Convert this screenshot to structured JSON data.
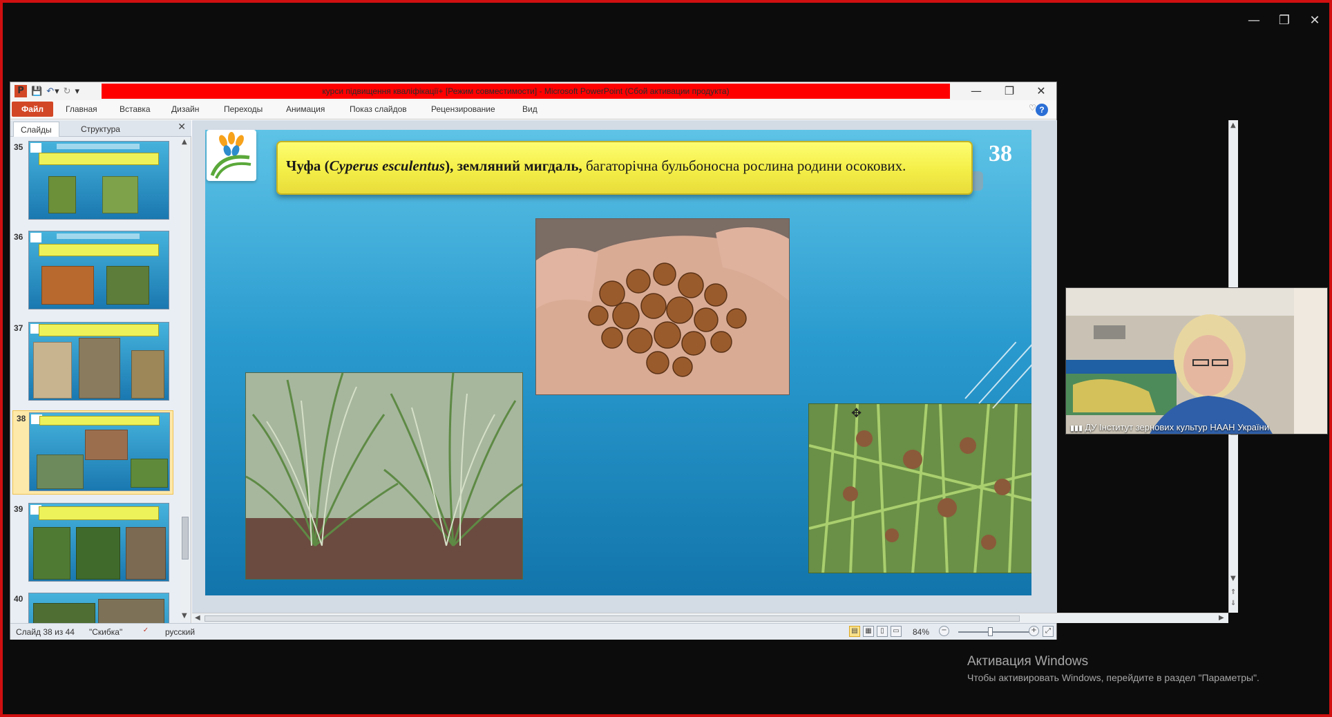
{
  "outer_window": {
    "controls": [
      "—",
      "❐",
      "✕"
    ]
  },
  "ppt": {
    "title": "курси підвищення кваліфікації+ [Режим совместимости]  -  Microsoft PowerPoint (Сбой активации продукта)",
    "qat": {
      "logo": "P",
      "save": "💾",
      "undo": "↶",
      "undo_dd": "▾",
      "redo": "↻",
      "customize": "▾"
    },
    "window_controls": {
      "minimize": "—",
      "restore": "❐",
      "close": "✕"
    },
    "ribbon": {
      "file_tab": "Файл",
      "tabs": [
        "Главная",
        "Вставка",
        "Дизайн",
        "Переходы",
        "Анимация",
        "Показ слайдов",
        "Рецензирование",
        "Вид"
      ],
      "collapse_icon": "♡",
      "help_icon": "?"
    },
    "left_pane": {
      "tabs": [
        "Слайды",
        "Структура"
      ],
      "close": "✕",
      "thumbnails": [
        {
          "num": "35",
          "selected": false
        },
        {
          "num": "36",
          "selected": false
        },
        {
          "num": "37",
          "selected": false
        },
        {
          "num": "38",
          "selected": true
        },
        {
          "num": "39",
          "selected": false
        },
        {
          "num": "40",
          "selected": false
        }
      ]
    },
    "slide": {
      "heading_bold": "Чуфа (",
      "heading_italic": "Cyperus esculentus",
      "heading_bold2": "), земляний мигдаль,",
      "heading_rest": " багаторічна бульбоносна рослина родини осокових.",
      "number": "38",
      "images": [
        "tiger-nuts-in-hand",
        "chufa-grass-clumps",
        "sedge-flower-heads"
      ]
    },
    "status_bar": {
      "slide_info": "Слайд 38 из 44",
      "theme": "\"Скибка\"",
      "language": "русский",
      "zoom": "84%",
      "zoom_out": "−",
      "zoom_in": "+"
    }
  },
  "webcam": {
    "caption": "ДУ Інститут зернових культур НААН України"
  },
  "watermark": {
    "title": "Активация Windows",
    "subtitle": "Чтобы активировать Windows, перейдите в раздел \"Параметры\"."
  },
  "colors": {
    "frame_border": "#d01010",
    "title_highlight": "#ff0000",
    "file_tab": "#d24726",
    "slide_header": "#f5f04a"
  }
}
